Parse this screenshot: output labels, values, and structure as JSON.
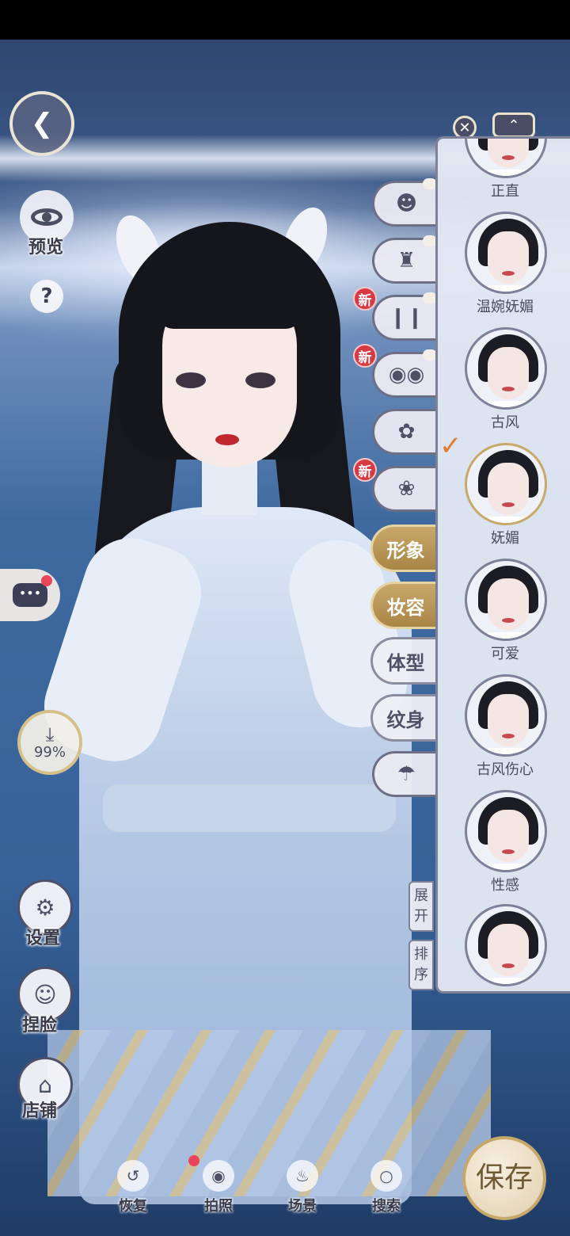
{
  "left": {
    "preview_label": "预览",
    "help_symbol": "?",
    "download_percent": "99%",
    "settings_label": "设置",
    "face_label": "捏脸",
    "shop_label": "店铺"
  },
  "tabs": {
    "new_badge": "新",
    "image_label": "形象",
    "makeup_label": "妆容",
    "body_label": "体型",
    "tattoo_label": "纹身"
  },
  "panel": {
    "faces": [
      {
        "label": "正直"
      },
      {
        "label": "温婉妩媚"
      },
      {
        "label": "古风"
      },
      {
        "label": "妩媚"
      },
      {
        "label": "可爱"
      },
      {
        "label": "古风伤心"
      },
      {
        "label": "性感"
      }
    ],
    "expand_label": "展开",
    "sort_label": "排序"
  },
  "bottom": {
    "restore_label": "恢复",
    "photo_label": "拍照",
    "scene_label": "场景",
    "search_label": "搜索",
    "save_label": "保存"
  }
}
